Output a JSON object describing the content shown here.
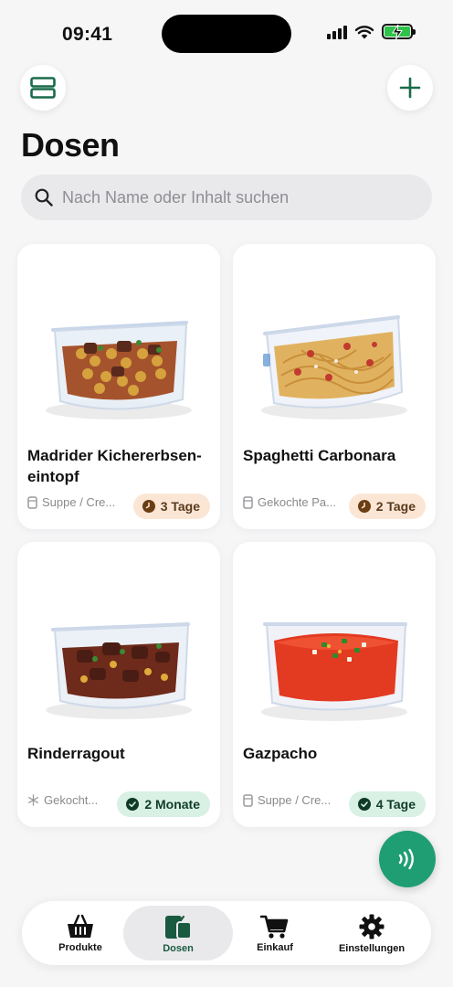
{
  "status_bar": {
    "time": "09:41"
  },
  "header": {
    "title": "Dosen"
  },
  "search": {
    "placeholder": "Nach Name oder Inhalt suchen",
    "value": ""
  },
  "containers": [
    {
      "name": "Madrider Kichererbsen-eintopf",
      "category": "Suppe / Cre...",
      "category_icon": "container-icon",
      "badge": "3 Tage",
      "badge_status": "warning",
      "badge_icon": "clock-icon"
    },
    {
      "name": "Spaghetti Carbonara",
      "category": "Gekochte Pa...",
      "category_icon": "container-icon",
      "badge": "2 Tage",
      "badge_status": "warning",
      "badge_icon": "clock-icon"
    },
    {
      "name": "Rinderragout",
      "category": "Gekocht...",
      "category_icon": "snowflake-icon",
      "badge": "2 Monate",
      "badge_status": "ok",
      "badge_icon": "check-circle-icon"
    },
    {
      "name": "Gazpacho",
      "category": "Suppe / Cre...",
      "category_icon": "container-icon",
      "badge": "4 Tage",
      "badge_status": "ok",
      "badge_icon": "check-circle-icon"
    }
  ],
  "tabbar": {
    "items": [
      {
        "label": "Produkte",
        "icon": "basket-icon"
      },
      {
        "label": "Dosen",
        "icon": "containers-icon",
        "active": true
      },
      {
        "label": "Einkauf",
        "icon": "cart-icon"
      },
      {
        "label": "Einstellungen",
        "icon": "gear-icon"
      }
    ]
  },
  "colors": {
    "accent": "#1f9e74",
    "warning_bg": "#fbe6d5",
    "ok_bg": "#d9f0e5",
    "background": "#f6f6f7"
  }
}
